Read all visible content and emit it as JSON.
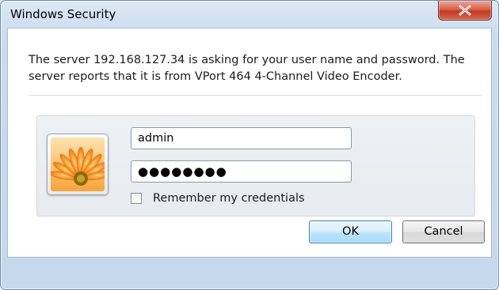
{
  "window": {
    "title": "Windows Security",
    "close_icon": "close-icon"
  },
  "message": {
    "text": "The server 192.168.127.34 is asking for your user name and password. The server reports that it is from VPort 464 4-Channel Video Encoder."
  },
  "credentials": {
    "username_value": "admin",
    "password_masked": "●●●●●●●●",
    "remember_label": "Remember my credentials",
    "remember_checked": false,
    "avatar_icon": "user-tile-flower-icon"
  },
  "buttons": {
    "ok_label": "OK",
    "cancel_label": "Cancel"
  },
  "colors": {
    "close_button": "#c9442b",
    "ok_button_border": "#3c7fb1"
  }
}
